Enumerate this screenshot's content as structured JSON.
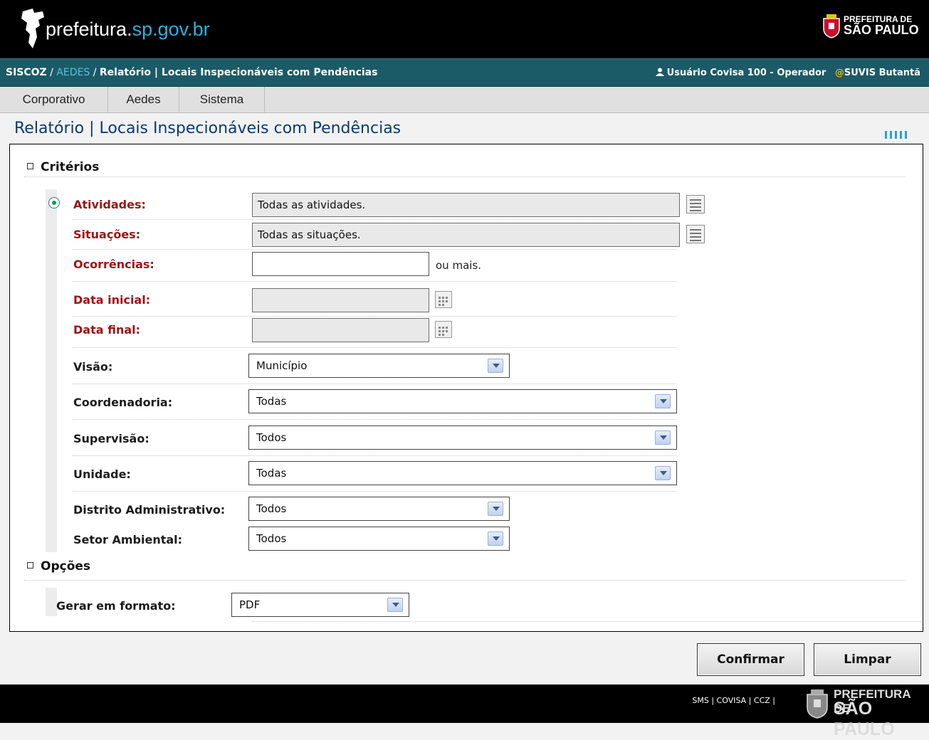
{
  "header": {
    "site_name_prefix": "prefeitura.",
    "site_name_accent": "sp.gov.br",
    "brand_line1": "PREFEITURA DE",
    "brand_line2": "SÃO PAULO"
  },
  "breadcrumb": {
    "root": "SISCOZ",
    "sep1": " / ",
    "module": "AEDES",
    "sep2": " / ",
    "current": "Relatório | Locais Inspecionáveis com Pendências"
  },
  "user": {
    "name": "Usuário Covisa 100 - Operador",
    "at_symbol": "@",
    "unit": "SUVIS Butantã"
  },
  "menu": {
    "items": [
      {
        "label": "Corporativo"
      },
      {
        "label": "Aedes"
      },
      {
        "label": "Sistema"
      }
    ]
  },
  "page": {
    "title": "Relatório | Locais Inspecionáveis com Pendências"
  },
  "criteria": {
    "section_label": "Critérios",
    "atividades": {
      "label": "Atividades:",
      "value": "Todas as atividades."
    },
    "situacoes": {
      "label": "Situações:",
      "value": "Todas as situações."
    },
    "ocorrencias": {
      "label": "Ocorrências:",
      "value": "",
      "suffix": "ou mais."
    },
    "data_inicial": {
      "label": "Data inicial:",
      "value": ""
    },
    "data_final": {
      "label": "Data final:",
      "value": ""
    },
    "visao": {
      "label": "Visão:",
      "value": "Município"
    },
    "coordenadoria": {
      "label": "Coordenadoria:",
      "value": "Todas"
    },
    "supervisao": {
      "label": "Supervisão:",
      "value": "Todos"
    },
    "unidade": {
      "label": "Unidade:",
      "value": "Todas"
    },
    "distrito": {
      "label": "Distrito Administrativo:",
      "value": "Todos"
    },
    "setor": {
      "label": "Setor Ambiental:",
      "value": "Todos"
    }
  },
  "options": {
    "section_label": "Opções",
    "formato": {
      "label": "Gerar em formato:",
      "value": "PDF"
    }
  },
  "actions": {
    "confirm_label": "Confirmar",
    "clear_label": "Limpar"
  },
  "footer": {
    "links": "SMS | COVISA | CCZ |",
    "brand_line1": "PREFEITURA DE",
    "brand_line2": "SÃO PAULO"
  },
  "colors": {
    "header_bg": "#000000",
    "breadcrumb_bg": "#1b5a66",
    "accent_blue": "#2cb0e2",
    "title_blue": "#0d3a6c",
    "required_label_red": "#9a1515"
  }
}
